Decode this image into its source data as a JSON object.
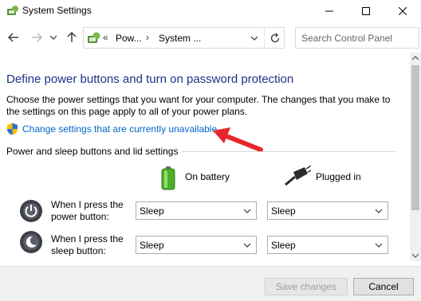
{
  "window": {
    "title": "System Settings",
    "min_icon": "minimize-icon",
    "max_icon": "maximize-icon",
    "close_icon": "close-icon"
  },
  "nav": {
    "back_icon": "back-arrow-icon",
    "forward_icon": "forward-arrow-icon",
    "recent_icon": "chevron-down-icon",
    "up_icon": "up-arrow-icon"
  },
  "address": {
    "overflow": "«",
    "crumb1": "Pow...",
    "separator": "›",
    "crumb2": "System ...",
    "refresh_icon": "refresh-icon"
  },
  "search": {
    "placeholder": "Search Control Panel",
    "icon": "search-icon"
  },
  "content": {
    "heading": "Define power buttons and turn on password protection",
    "description": "Choose the power settings that you want for your computer. The changes that you make to the settings on this page apply to all of your power plans.",
    "change_link": "Change settings that are currently unavailable",
    "section_title": "Power and sleep buttons and lid settings",
    "on_battery": "On battery",
    "plugged_in": "Plugged in",
    "rows": [
      {
        "label": "When I press the power button:",
        "battery": "Sleep",
        "plugged": "Sleep"
      },
      {
        "label": "When I press the sleep button:",
        "battery": "Sleep",
        "plugged": "Sleep"
      }
    ]
  },
  "footer": {
    "save": "Save changes",
    "cancel": "Cancel"
  },
  "colors": {
    "heading": "#1e3287",
    "link": "#0066cc",
    "annotation_arrow": "#e8262b"
  }
}
